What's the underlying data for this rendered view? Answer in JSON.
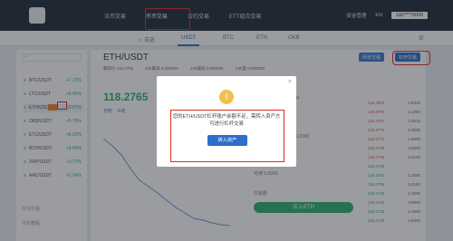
{
  "nav": {
    "items": [
      "法币交易",
      "币币交易",
      "合约交易",
      "ETT组合交易"
    ],
    "active_index": 1,
    "right_items": [
      "资金管理",
      "EN",
      "182****0000"
    ]
  },
  "subtabs": {
    "items": [
      "☆ 自选",
      "USDT",
      "BTC",
      "ETH",
      "OKB"
    ],
    "active": "USDT"
  },
  "sidebar": {
    "pairs": [
      {
        "name": "BTC/USDT",
        "change": "+7.37%",
        "up": true
      },
      {
        "name": "LTC/USDT",
        "change": "+8.45%",
        "up": true
      },
      {
        "name": "ETH/USDT",
        "change": "+9.07%",
        "up": true,
        "selected": true
      },
      {
        "name": "OKB/USDT",
        "change": "+5.76%",
        "up": true
      },
      {
        "name": "ETC/USDT",
        "change": "+6.02%",
        "up": true
      },
      {
        "name": "BCH/USDT",
        "change": "+4.89%",
        "up": true
      },
      {
        "name": "XRP/USDT",
        "change": "+3.77%",
        "up": true
      },
      {
        "name": "AAC/USDT",
        "change": "+2.54%",
        "up": true
      }
    ],
    "sections": [
      "币币交易",
      "币币教程"
    ]
  },
  "main": {
    "title": "ETH/USDT",
    "stats": [
      "最新价 118.2765",
      "24h最高 0.000000",
      "24h最低 0.000000",
      "24h量 0.000000"
    ],
    "price": "118.2765",
    "buttons": [
      "币币交易",
      "杠杆交易"
    ],
    "tabs": [
      "分时",
      "K线"
    ],
    "buy_label": "买入ETH",
    "panel_labels": [
      "最新ETH",
      "0.0000",
      "可用 0.0000",
      "交易额"
    ],
    "orderbook": [
      {
        "p": "118.2802",
        "q": "0.9410",
        "side": "sell"
      },
      {
        "p": "118.2790",
        "q": "1.1200",
        "side": "sell"
      },
      {
        "p": "118.2781",
        "q": "2.0510",
        "side": "sell"
      },
      {
        "p": "118.2776",
        "q": "0.3000",
        "side": "sell"
      },
      {
        "p": "118.2771",
        "q": "1.5000",
        "side": "sell"
      },
      {
        "p": "118.2768",
        "q": "0.8000",
        "side": "sell"
      },
      {
        "p": "118.2766",
        "q": "3.2100",
        "side": "sell"
      },
      {
        "p": "118.2765",
        "q": "",
        "side": "buy"
      },
      {
        "p": "118.2760",
        "q": "1.2000",
        "side": "buy"
      },
      {
        "p": "118.2755",
        "q": "0.4100",
        "side": "buy"
      },
      {
        "p": "118.2748",
        "q": "2.3000",
        "side": "buy"
      },
      {
        "p": "118.2740",
        "q": "0.9900",
        "side": "buy"
      },
      {
        "p": "118.2732",
        "q": "1.0500",
        "side": "buy"
      },
      {
        "p": "118.2725",
        "q": "0.6300",
        "side": "buy"
      }
    ]
  },
  "modal": {
    "icon": "warning-icon",
    "message": "您的ETH/USDT杠杆账户余额不足，需转入资产方可进行杠杆交易",
    "button": "转入资产",
    "close": "×"
  },
  "colors": {
    "nav_bg": "#1f2b3a",
    "accent": "#2c6fc8",
    "up": "#2eb36a",
    "down": "#e45353",
    "highlight": "#e02b20"
  }
}
